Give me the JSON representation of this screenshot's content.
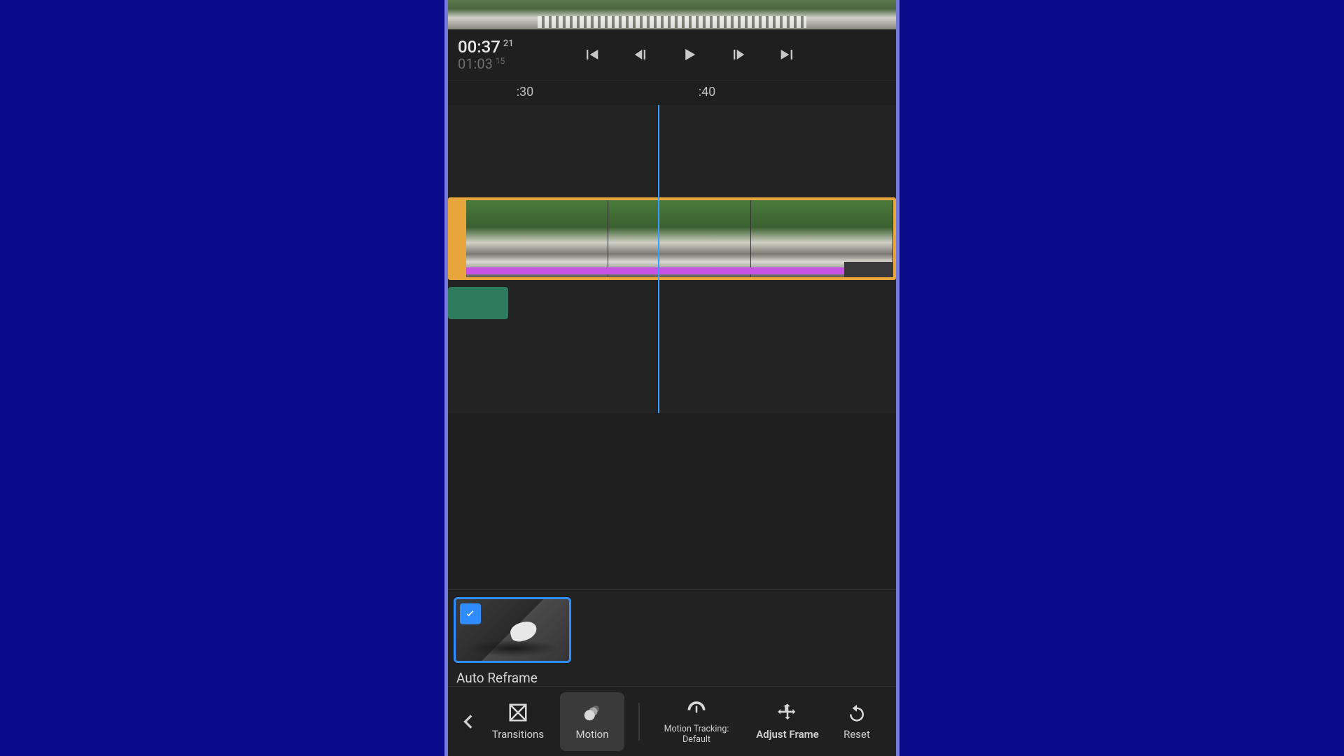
{
  "playback": {
    "current_time": "00:37",
    "current_frames": "21",
    "total_time": "01:03",
    "total_frames": "15"
  },
  "ruler": {
    "tick1": ":30",
    "tick2": ":40"
  },
  "options": {
    "auto_reframe_label": "Auto Reframe"
  },
  "toolbar": {
    "transitions": "Transitions",
    "motion": "Motion",
    "motion_tracking": "Motion Tracking: Default",
    "adjust_frame": "Adjust Frame",
    "reset": "Reset"
  }
}
